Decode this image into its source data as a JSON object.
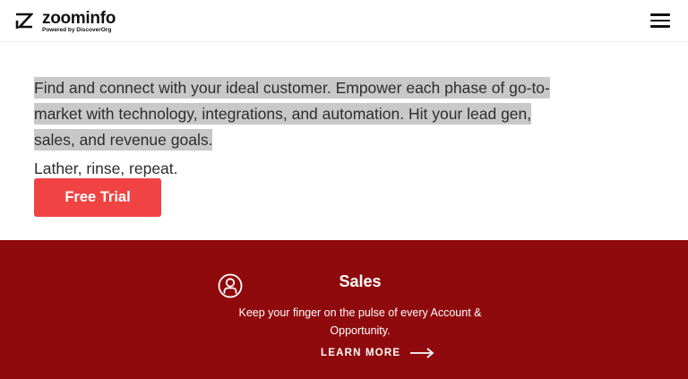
{
  "header": {
    "brand": "zoominfo",
    "tagline": "Powered by DiscoverOrg",
    "logo_icon": "zoominfo-z-logo",
    "menu_icon": "hamburger-menu-icon"
  },
  "hero": {
    "intro": "Find and connect with your ideal customer. Empower each phase of go-to-market with technology, integrations, and automation. Hit your lead gen, sales, and revenue goals.",
    "tagline": "Lather, rinse, repeat.",
    "cta_label": "Free Trial"
  },
  "feature": {
    "icon": "user-circle-icon",
    "title": "Sales",
    "description": "Keep your finger on the pulse of every Account & Opportunity.",
    "link_label": "LEARN MORE",
    "link_icon": "arrow-right-icon"
  },
  "colors": {
    "accent": "#f14343",
    "band": "#8f0a0d",
    "highlight": "#c8c8c8"
  }
}
